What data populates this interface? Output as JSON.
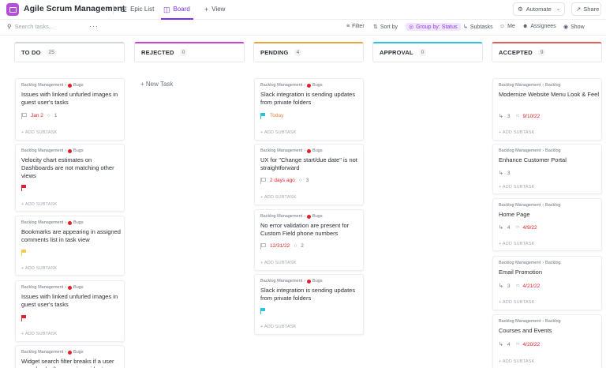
{
  "header": {
    "title": "Agile Scrum Management",
    "tabs": {
      "epic_list": "Epic List",
      "board": "Board",
      "add_view": "View"
    },
    "automate": "Automate",
    "share": "Share"
  },
  "toolbar": {
    "search_placeholder": "Search tasks...",
    "more": "···",
    "filter": "Filter",
    "sort": "Sort by",
    "group": "Group by: Status",
    "subtasks": "Subtasks",
    "me": "Me",
    "assignees": "Assignees",
    "show": "Show"
  },
  "columns": [
    {
      "name": "TO DO",
      "count": "25",
      "color": "#d3d6db"
    },
    {
      "name": "REJECTED",
      "count": "0",
      "color": "#cc40d8"
    },
    {
      "name": "PENDING",
      "count": "4",
      "color": "#e8a33a"
    },
    {
      "name": "APPROVAL",
      "count": "0",
      "color": "#2fc2da"
    },
    {
      "name": "ACCEPTED",
      "count": "9",
      "color": "#e25c5c"
    }
  ],
  "new_task": "+ New Task",
  "add_subtask": "+ ADD SUBTASK",
  "todo": [
    {
      "crumb": "Backlog Management",
      "tag": "Bugs",
      "title": "Issues with linked unfurled images in guest user's tasks",
      "date": "Jan 2",
      "count": "1"
    },
    {
      "crumb": "Backlog Management",
      "tag": "Bugs",
      "title": "Velocity chart estimates on Dashboards are not matching other views"
    },
    {
      "crumb": "Backlog Management",
      "tag": "Bugs",
      "title": "Bookmarks are appearing in assigned comments list in task view"
    },
    {
      "crumb": "Backlog Management",
      "tag": "Bugs",
      "title": "Issues with linked unfurled images in guest user's tasks"
    },
    {
      "crumb": "Backlog Management",
      "tag": "Bugs",
      "title": "Widget search filter breaks if a user goes back after opening widget"
    }
  ],
  "pending": [
    {
      "crumb": "Backlog Management",
      "tag": "Bugs",
      "title": "Slack integration is sending updates from private folders",
      "date": "Today"
    },
    {
      "crumb": "Backlog Management",
      "tag": "Bugs",
      "title": "UX for \"Change start/due date\" is not straightforward",
      "date": "2 days ago",
      "count": "3"
    },
    {
      "crumb": "Backlog Management",
      "tag": "Bugs",
      "title": "No error validation are present for Custom Field phone numbers",
      "date": "12/31/22",
      "count": "2"
    },
    {
      "crumb": "Backlog Management",
      "tag": "Bugs",
      "title": "Slack integration is sending updates from private folders"
    }
  ],
  "accepted": [
    {
      "crumb": "Backlog Management",
      "crumb2": "Backlog",
      "title": "Modernize Website Menu Look & Feel",
      "subtasks": "3",
      "date": "9/10/22"
    },
    {
      "crumb": "Backlog Management",
      "crumb2": "Backlog",
      "title": "Enhance Customer Portal",
      "subtasks": "3"
    },
    {
      "crumb": "Backlog Management",
      "crumb2": "Backlog",
      "title": "Home Page",
      "subtasks": "4",
      "date": "4/9/22"
    },
    {
      "crumb": "Backlog Management",
      "crumb2": "Backlog",
      "title": "Email Promotion",
      "subtasks": "3",
      "date": "4/21/22"
    },
    {
      "crumb": "Backlog Management",
      "crumb2": "Backlog",
      "title": "Courses and Events",
      "subtasks": "4",
      "date": "4/20/22"
    }
  ],
  "colors": {
    "accent": "#7b2ff2",
    "app_icon": "#b34fd6",
    "bug_dot": "#e0202a",
    "flag_red": "#e0202a",
    "flag_yellow": "#f2c94c",
    "flag_cyan": "#2fc2da",
    "flag_gray": "#b9bec6"
  }
}
